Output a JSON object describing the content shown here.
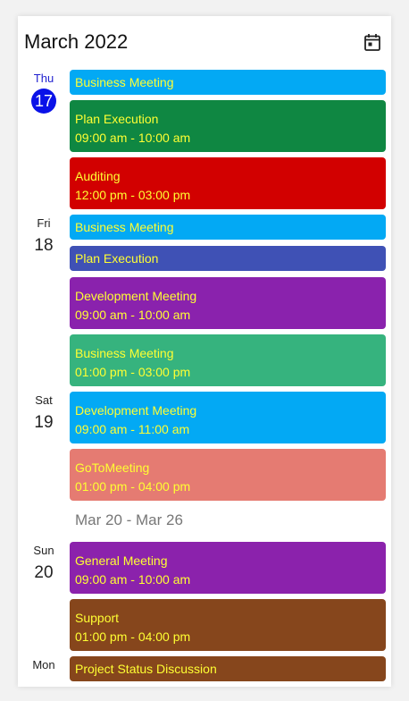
{
  "header": {
    "title": "March 2022",
    "calendar_icon": "calendar-today-icon"
  },
  "days": [
    {
      "dow": "Thu",
      "dom": "17",
      "today": true
    },
    {
      "dow": "Fri",
      "dom": "18"
    },
    {
      "dow": "Sat",
      "dom": "19"
    },
    {
      "dow": "Sun",
      "dom": "20"
    },
    {
      "dow": "Mon",
      "dom": ""
    }
  ],
  "week_separator": "Mar 20 - Mar 26",
  "events": [
    {
      "title": "Business Meeting",
      "time": "",
      "color": "#03a9f4"
    },
    {
      "title": "Plan Execution",
      "time": "09:00 am - 10:00 am",
      "color": "#0f8742"
    },
    {
      "title": "Auditing",
      "time": "12:00 pm - 03:00 pm",
      "color": "#d20000"
    },
    {
      "title": "Business Meeting",
      "time": "",
      "color": "#03a9f4"
    },
    {
      "title": "Plan Execution",
      "time": "",
      "color": "#3f51b5"
    },
    {
      "title": "Development Meeting",
      "time": "09:00 am - 10:00 am",
      "color": "#8a22ad"
    },
    {
      "title": "Business Meeting",
      "time": "01:00 pm - 03:00 pm",
      "color": "#36b37e"
    },
    {
      "title": "Development Meeting",
      "time": "09:00 am - 11:00 am",
      "color": "#03a9f4"
    },
    {
      "title": "GoToMeeting",
      "time": "01:00 pm - 04:00 pm",
      "color": "#e57b72"
    },
    {
      "title": "General Meeting",
      "time": "09:00 am - 10:00 am",
      "color": "#8b22ac"
    },
    {
      "title": "Support",
      "time": "01:00 pm - 04:00 pm",
      "color": "#86461c"
    },
    {
      "title": "Project Status Discussion",
      "time": "",
      "color": "#86461c"
    }
  ]
}
